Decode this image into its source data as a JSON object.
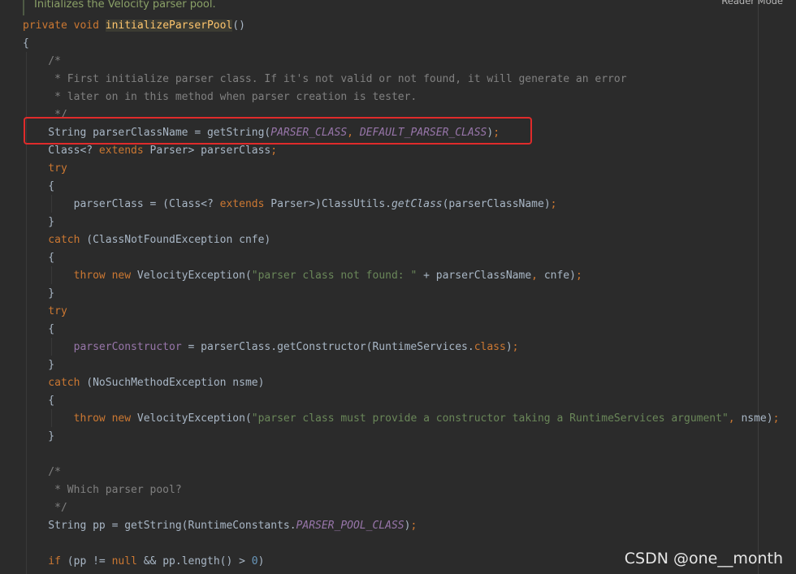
{
  "doc_comment": "Initializes the Velocity parser pool.",
  "reader_mode": "Reader Mode",
  "watermark": "CSDN @one__month",
  "code_lines": [
    [
      {
        "t": "kw",
        "v": "private void "
      },
      {
        "t": "fn",
        "v": "initializeParserPool"
      },
      {
        "t": "plain",
        "v": "()"
      }
    ],
    [
      {
        "t": "plain",
        "v": "{"
      }
    ],
    [
      {
        "t": "comment",
        "v": "    /*"
      }
    ],
    [
      {
        "t": "comment",
        "v": "     * First initialize parser class. If it's not valid or not found, it will generate an error"
      }
    ],
    [
      {
        "t": "comment",
        "v": "     * later on in this method when parser creation is tester."
      }
    ],
    [
      {
        "t": "comment",
        "v": "     */"
      }
    ],
    [
      {
        "t": "plain",
        "v": "    String parserClassName = getString("
      },
      {
        "t": "const",
        "v": "PARSER_CLASS"
      },
      {
        "t": "kw",
        "v": ", "
      },
      {
        "t": "const",
        "v": "DEFAULT_PARSER_CLASS"
      },
      {
        "t": "plain",
        "v": ")"
      },
      {
        "t": "kw",
        "v": ";"
      }
    ],
    [
      {
        "t": "plain",
        "v": "    Class<? "
      },
      {
        "t": "kw",
        "v": "extends "
      },
      {
        "t": "plain",
        "v": "Parser> parserClass"
      },
      {
        "t": "kw",
        "v": ";"
      }
    ],
    [
      {
        "t": "kw",
        "v": "    try"
      }
    ],
    [
      {
        "t": "plain",
        "v": "    {"
      }
    ],
    [
      {
        "t": "plain",
        "v": "        parserClass = (Class<? "
      },
      {
        "t": "kw",
        "v": "extends "
      },
      {
        "t": "plain",
        "v": "Parser>)ClassUtils."
      },
      {
        "t": "italic",
        "v": "getClass"
      },
      {
        "t": "plain",
        "v": "(parserClassName)"
      },
      {
        "t": "kw",
        "v": ";"
      }
    ],
    [
      {
        "t": "plain",
        "v": "    }"
      }
    ],
    [
      {
        "t": "kw",
        "v": "    catch "
      },
      {
        "t": "plain",
        "v": "(ClassNotFoundException cnfe)"
      }
    ],
    [
      {
        "t": "plain",
        "v": "    {"
      }
    ],
    [
      {
        "t": "kw",
        "v": "        throw new "
      },
      {
        "t": "plain",
        "v": "VelocityException("
      },
      {
        "t": "str",
        "v": "\"parser class not found: \" "
      },
      {
        "t": "plain",
        "v": "+ parserClassName"
      },
      {
        "t": "kw",
        "v": ", "
      },
      {
        "t": "plain",
        "v": "cnfe)"
      },
      {
        "t": "kw",
        "v": ";"
      }
    ],
    [
      {
        "t": "plain",
        "v": "    }"
      }
    ],
    [
      {
        "t": "kw",
        "v": "    try"
      }
    ],
    [
      {
        "t": "plain",
        "v": "    {"
      }
    ],
    [
      {
        "t": "field",
        "v": "        parserConstructor "
      },
      {
        "t": "plain",
        "v": "= parserClass.getConstructor(RuntimeServices."
      },
      {
        "t": "kw",
        "v": "class"
      },
      {
        "t": "plain",
        "v": ")"
      },
      {
        "t": "kw",
        "v": ";"
      }
    ],
    [
      {
        "t": "plain",
        "v": "    }"
      }
    ],
    [
      {
        "t": "kw",
        "v": "    catch "
      },
      {
        "t": "plain",
        "v": "(NoSuchMethodException nsme)"
      }
    ],
    [
      {
        "t": "plain",
        "v": "    {"
      }
    ],
    [
      {
        "t": "kw",
        "v": "        throw new "
      },
      {
        "t": "plain",
        "v": "VelocityException("
      },
      {
        "t": "str",
        "v": "\"parser class must provide a constructor taking a RuntimeServices argument\""
      },
      {
        "t": "kw",
        "v": ", "
      },
      {
        "t": "plain",
        "v": "nsme)"
      },
      {
        "t": "kw",
        "v": ";"
      }
    ],
    [
      {
        "t": "plain",
        "v": "    }"
      }
    ],
    [
      {
        "t": "plain",
        "v": ""
      }
    ],
    [
      {
        "t": "comment",
        "v": "    /*"
      }
    ],
    [
      {
        "t": "comment",
        "v": "     * Which parser pool?"
      }
    ],
    [
      {
        "t": "comment",
        "v": "     */"
      }
    ],
    [
      {
        "t": "plain",
        "v": "    String pp = getString(RuntimeConstants."
      },
      {
        "t": "const",
        "v": "PARSER_POOL_CLASS"
      },
      {
        "t": "plain",
        "v": ")"
      },
      {
        "t": "kw",
        "v": ";"
      }
    ],
    [
      {
        "t": "plain",
        "v": ""
      }
    ],
    [
      {
        "t": "kw",
        "v": "    if "
      },
      {
        "t": "plain",
        "v": "(pp != "
      },
      {
        "t": "kw",
        "v": "null "
      },
      {
        "t": "plain",
        "v": "&& pp.length() > "
      },
      {
        "t": "num",
        "v": "0"
      },
      {
        "t": "plain",
        "v": ")"
      }
    ]
  ]
}
